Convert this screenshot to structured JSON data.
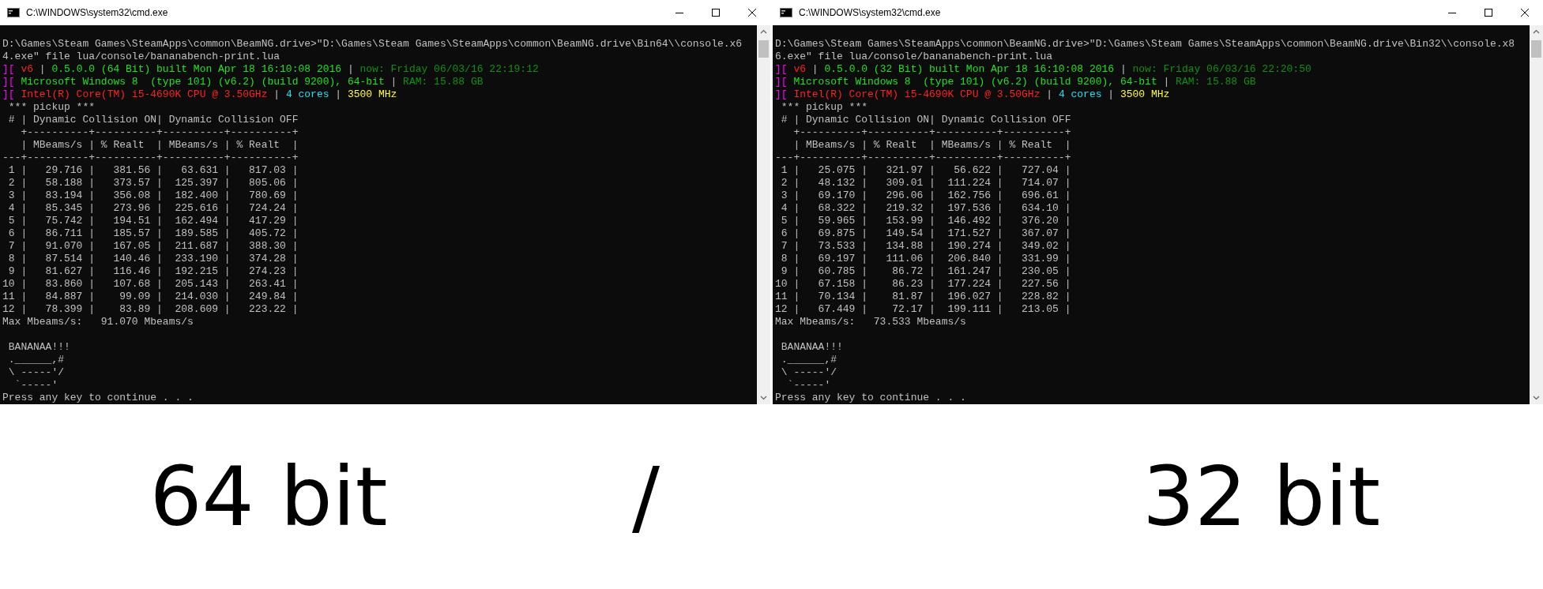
{
  "windows": [
    {
      "title": "C:\\WINDOWS\\system32\\cmd.exe",
      "lines": [
        {
          "kind": "plain",
          "text": "D:\\Games\\Steam Games\\SteamApps\\common\\BeamNG.drive>\"D:\\Games\\Steam Games\\SteamApps\\common\\BeamNG.drive\\Bin64\\\\console.x6"
        },
        {
          "kind": "plain",
          "text": "4.exe\" file lua/console/bananabench-print.lua"
        },
        {
          "kind": "colored",
          "segments": [
            {
              "text": "][",
              "color": "#ff00ff"
            },
            {
              "text": " v6",
              "color": "#ff2020"
            },
            {
              "text": " | "
            },
            {
              "text": "0.5.0.0 (64 Bit) built Mon Apr 18 16:10:08 2016",
              "color": "#20e020"
            },
            {
              "text": " | "
            },
            {
              "text": "now: Friday 06/03/16 22:19:12",
              "color": "#109010"
            }
          ]
        },
        {
          "kind": "colored",
          "segments": [
            {
              "text": "][",
              "color": "#ff00ff"
            },
            {
              "text": " Microsoft Windows 8  (type 101) (v6.2) (build 9200), 64-bit",
              "color": "#20e020"
            },
            {
              "text": " | ",
              "color": "#c0c0c0"
            },
            {
              "text": "RAM: 15.88 GB",
              "color": "#109010"
            }
          ]
        },
        {
          "kind": "colored",
          "segments": [
            {
              "text": "][",
              "color": "#ff00ff"
            },
            {
              "text": " Intel(R) Core(TM) i5-4690K CPU @ 3.50GHz",
              "color": "#ff2020"
            },
            {
              "text": " | "
            },
            {
              "text": "4 cores",
              "color": "#20e0f0"
            },
            {
              "text": " | "
            },
            {
              "text": "3500 MHz",
              "color": "#ffff20"
            }
          ]
        },
        {
          "kind": "plain",
          "text": " *** pickup ***"
        },
        {
          "kind": "plain",
          "text": " # | Dynamic Collision ON| Dynamic Collision OFF"
        },
        {
          "kind": "plain",
          "text": "   +----------+----------+----------+----------+"
        },
        {
          "kind": "plain",
          "text": "   | MBeams/s | % Realt  | MBeams/s | % Realt  |"
        },
        {
          "kind": "plain",
          "text": "---+----------+----------+----------+----------+"
        },
        {
          "kind": "plain",
          "text": " 1 |   29.716 |   381.56 |   63.631 |   817.03 |"
        },
        {
          "kind": "plain",
          "text": " 2 |   58.188 |   373.57 |  125.397 |   805.06 |"
        },
        {
          "kind": "plain",
          "text": " 3 |   83.194 |   356.08 |  182.400 |   780.69 |"
        },
        {
          "kind": "plain",
          "text": " 4 |   85.345 |   273.96 |  225.616 |   724.24 |"
        },
        {
          "kind": "plain",
          "text": " 5 |   75.742 |   194.51 |  162.494 |   417.29 |"
        },
        {
          "kind": "plain",
          "text": " 6 |   86.711 |   185.57 |  189.585 |   405.72 |"
        },
        {
          "kind": "plain",
          "text": " 7 |   91.070 |   167.05 |  211.687 |   388.30 |"
        },
        {
          "kind": "plain",
          "text": " 8 |   87.514 |   140.46 |  233.190 |   374.28 |"
        },
        {
          "kind": "plain",
          "text": " 9 |   81.627 |   116.46 |  192.215 |   274.23 |"
        },
        {
          "kind": "plain",
          "text": "10 |   83.860 |   107.68 |  205.143 |   263.41 |"
        },
        {
          "kind": "plain",
          "text": "11 |   84.887 |    99.09 |  214.030 |   249.84 |"
        },
        {
          "kind": "plain",
          "text": "12 |   78.399 |    83.89 |  208.609 |   223.22 |"
        },
        {
          "kind": "plain",
          "text": "Max Mbeams/s:   91.070 Mbeams/s"
        },
        {
          "kind": "blank"
        },
        {
          "kind": "plain",
          "text": " BANANAA!!!"
        },
        {
          "kind": "plain",
          "text": " .______,#"
        },
        {
          "kind": "plain",
          "text": " \\ -----'/"
        },
        {
          "kind": "plain",
          "text": "  `-----'"
        },
        {
          "kind": "plain",
          "text": "Press any key to continue . . ."
        }
      ]
    },
    {
      "title": "C:\\WINDOWS\\system32\\cmd.exe",
      "lines": [
        {
          "kind": "plain",
          "text": "D:\\Games\\Steam Games\\SteamApps\\common\\BeamNG.drive>\"D:\\Games\\Steam Games\\SteamApps\\common\\BeamNG.drive\\Bin32\\\\console.x8"
        },
        {
          "kind": "plain",
          "text": "6.exe\" file lua/console/bananabench-print.lua"
        },
        {
          "kind": "colored",
          "segments": [
            {
              "text": "][",
              "color": "#ff00ff"
            },
            {
              "text": " v6",
              "color": "#ff2020"
            },
            {
              "text": " | "
            },
            {
              "text": "0.5.0.0 (32 Bit) built Mon Apr 18 16:10:08 2016",
              "color": "#20e020"
            },
            {
              "text": " | "
            },
            {
              "text": "now: Friday 06/03/16 22:20:50",
              "color": "#109010"
            }
          ]
        },
        {
          "kind": "colored",
          "segments": [
            {
              "text": "][",
              "color": "#ff00ff"
            },
            {
              "text": " Microsoft Windows 8  (type 101) (v6.2) (build 9200), 64-bit",
              "color": "#20e020"
            },
            {
              "text": " | ",
              "color": "#c0c0c0"
            },
            {
              "text": "RAM: 15.88 GB",
              "color": "#109010"
            }
          ]
        },
        {
          "kind": "colored",
          "segments": [
            {
              "text": "][",
              "color": "#ff00ff"
            },
            {
              "text": " Intel(R) Core(TM) i5-4690K CPU @ 3.50GHz",
              "color": "#ff2020"
            },
            {
              "text": " | "
            },
            {
              "text": "4 cores",
              "color": "#20e0f0"
            },
            {
              "text": " | "
            },
            {
              "text": "3500 MHz",
              "color": "#ffff20"
            }
          ]
        },
        {
          "kind": "plain",
          "text": " *** pickup ***"
        },
        {
          "kind": "plain",
          "text": " # | Dynamic Collision ON| Dynamic Collision OFF"
        },
        {
          "kind": "plain",
          "text": "   +----------+----------+----------+----------+"
        },
        {
          "kind": "plain",
          "text": "   | MBeams/s | % Realt  | MBeams/s | % Realt  |"
        },
        {
          "kind": "plain",
          "text": "---+----------+----------+----------+----------+"
        },
        {
          "kind": "plain",
          "text": " 1 |   25.075 |   321.97 |   56.622 |   727.04 |"
        },
        {
          "kind": "plain",
          "text": " 2 |   48.132 |   309.01 |  111.224 |   714.07 |"
        },
        {
          "kind": "plain",
          "text": " 3 |   69.170 |   296.06 |  162.756 |   696.61 |"
        },
        {
          "kind": "plain",
          "text": " 4 |   68.322 |   219.32 |  197.536 |   634.10 |"
        },
        {
          "kind": "plain",
          "text": " 5 |   59.965 |   153.99 |  146.492 |   376.20 |"
        },
        {
          "kind": "plain",
          "text": " 6 |   69.875 |   149.54 |  171.527 |   367.07 |"
        },
        {
          "kind": "plain",
          "text": " 7 |   73.533 |   134.88 |  190.274 |   349.02 |"
        },
        {
          "kind": "plain",
          "text": " 8 |   69.197 |   111.06 |  206.840 |   331.99 |"
        },
        {
          "kind": "plain",
          "text": " 9 |   60.785 |    86.72 |  161.247 |   230.05 |"
        },
        {
          "kind": "plain",
          "text": "10 |   67.158 |    86.23 |  177.224 |   227.56 |"
        },
        {
          "kind": "plain",
          "text": "11 |   70.134 |    81.87 |  196.027 |   228.82 |"
        },
        {
          "kind": "plain",
          "text": "12 |   67.449 |    72.17 |  199.111 |   213.05 |"
        },
        {
          "kind": "plain",
          "text": "Max Mbeams/s:   73.533 Mbeams/s"
        },
        {
          "kind": "blank"
        },
        {
          "kind": "plain",
          "text": " BANANAA!!!"
        },
        {
          "kind": "plain",
          "text": " .______,#"
        },
        {
          "kind": "plain",
          "text": " \\ -----'/"
        },
        {
          "kind": "plain",
          "text": "  `-----'"
        },
        {
          "kind": "plain",
          "text": "Press any key to continue . . ."
        }
      ]
    }
  ],
  "captions": [
    "64 bit",
    "/",
    "32 bit"
  ]
}
